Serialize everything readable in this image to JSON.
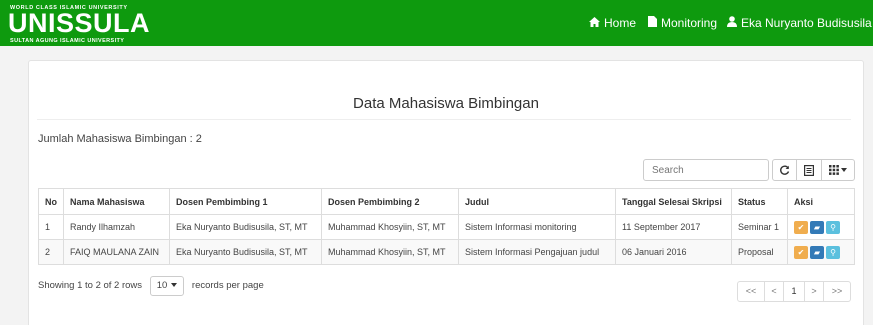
{
  "navbar": {
    "brand_top": "WORLD CLASS ISLAMIC UNIVERSITY",
    "brand_name": "UNISSULA",
    "brand_bottom": "SULTAN AGUNG ISLAMIC UNIVERSITY",
    "home_label": "Home",
    "monitoring_label": "Monitoring",
    "user_label": "Eka Nuryanto Budisusila",
    "bg_color": "#0e9a0e"
  },
  "panel": {
    "title": "Data Mahasiswa Bimbingan",
    "count_text": "Jumlah Mahasiswa Bimbingan : 2"
  },
  "toolbar": {
    "search_placeholder": "Search",
    "refresh_icon": "refresh-icon",
    "columns_icon": "list-icon",
    "grid_icon": "grid-icon"
  },
  "table": {
    "headers": [
      "No",
      "Nama Mahasiswa",
      "Dosen Pembimbing 1",
      "Dosen Pembimbing 2",
      "Judul",
      "Tanggal Selesai Skripsi",
      "Status",
      "Aksi"
    ],
    "rows": [
      {
        "no": "1",
        "nama": "Randy Ilhamzah",
        "dosen1": "Eka Nuryanto Budisusila, ST, MT",
        "dosen2": "Muhammad Khosyiin, ST, MT",
        "judul": "Sistem Informasi monitoring",
        "tanggal": "11 September 2017",
        "status": "Seminar 1"
      },
      {
        "no": "2",
        "nama": "FAIQ MAULANA ZAIN",
        "dosen1": "Eka Nuryanto Budisusila, ST, MT",
        "dosen2": "Muhammad Khosyiin, ST, MT",
        "judul": "Sistem Informasi Pengajuan judul",
        "tanggal": "06 Januari 2016",
        "status": "Proposal"
      }
    ]
  },
  "footer": {
    "showing_text": "Showing 1 to 2 of 2 rows",
    "page_size": "10",
    "records_text": "records per page",
    "pager": [
      "<<",
      "<",
      "1",
      ">",
      ">>"
    ]
  }
}
